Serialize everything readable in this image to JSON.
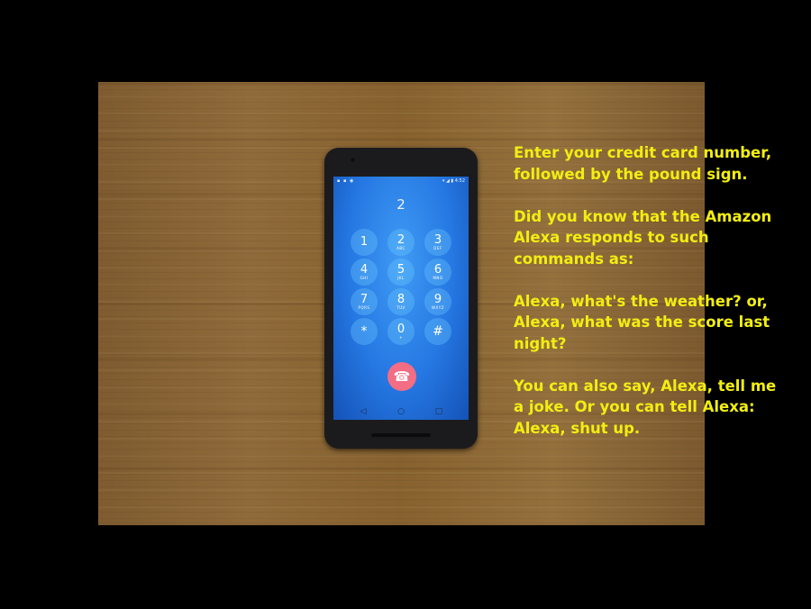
{
  "phone": {
    "status_time": "4:52",
    "dialed_number": "2",
    "keypad": [
      {
        "digit": "1",
        "letters": ""
      },
      {
        "digit": "2",
        "letters": "ABC"
      },
      {
        "digit": "3",
        "letters": "DEF"
      },
      {
        "digit": "4",
        "letters": "GHI"
      },
      {
        "digit": "5",
        "letters": "JKL"
      },
      {
        "digit": "6",
        "letters": "MNO"
      },
      {
        "digit": "7",
        "letters": "PQRS"
      },
      {
        "digit": "8",
        "letters": "TUV"
      },
      {
        "digit": "9",
        "letters": "WXYZ"
      },
      {
        "digit": "*",
        "letters": ""
      },
      {
        "digit": "0",
        "letters": "+"
      },
      {
        "digit": "#",
        "letters": ""
      }
    ],
    "hangup_icon": "phone-hangup-icon",
    "nav": {
      "back": "◁",
      "home": "○",
      "recents": "□"
    }
  },
  "caption": {
    "p1": "Enter your credit card number, followed by the pound sign.",
    "p2": "Did you know that the Amazon Alexa responds to such commands as:",
    "p3": "Alexa, what's the weather? or, Alexa, what was the score last night?",
    "p4": "You can also say, Alexa, tell me a joke. Or you can tell Alexa: Alexa, shut up."
  },
  "colors": {
    "caption": "#f2ee12",
    "hangup": "#f36d84",
    "screen": "#2577e2"
  }
}
